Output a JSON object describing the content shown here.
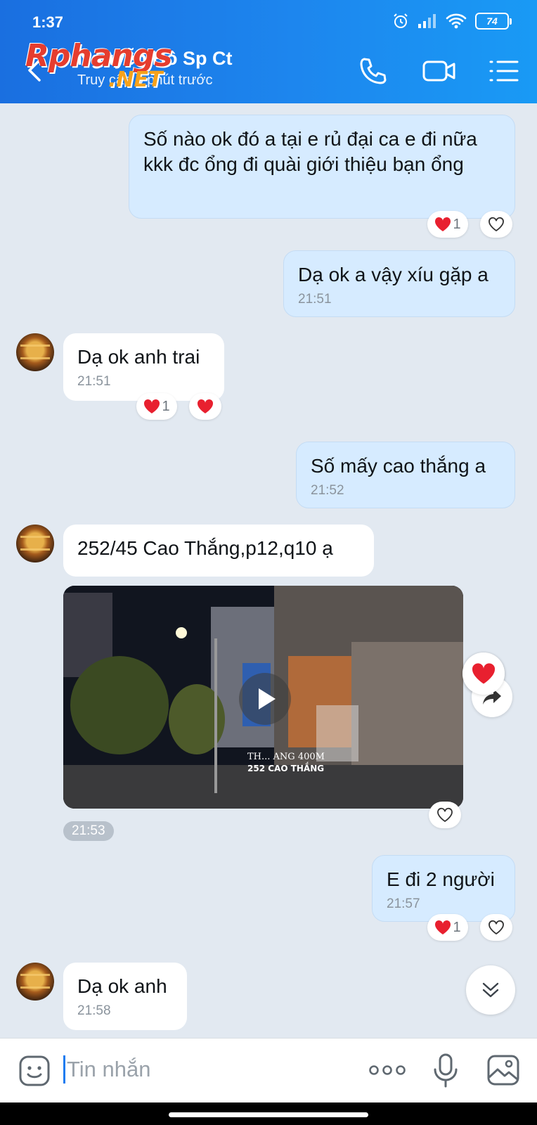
{
  "status_bar": {
    "time": "1:37",
    "battery": "74"
  },
  "header": {
    "contact_name": "Nguyễn Hồ Sp Ct",
    "subtitle": "Truy cập 5 phút trước",
    "watermark_line1": "Rphangs",
    "watermark_line2": ".NET"
  },
  "messages": {
    "m1": {
      "text": "Số nào ok đó a tại e rủ đại ca e đi nữa kkk đc ổng đi quài giới thiệu bạn ổng",
      "reaction_count": "1"
    },
    "m2": {
      "text": "Dạ ok a vậy xíu gặp a",
      "time": "21:51"
    },
    "m3": {
      "text": "Dạ ok anh trai",
      "time": "21:51",
      "reaction_count": "1"
    },
    "m4": {
      "text": "Số mấy cao thắng a",
      "time": "21:52"
    },
    "m5": {
      "text": "252/45 Cao Thắng,p12,q10 ạ"
    },
    "m6": {
      "video_overlay_line1": "TH... ANG 400M",
      "video_overlay_line2": "252 CAO THẮNG",
      "time": "21:53"
    },
    "m7": {
      "text": "E đi 2 người",
      "time": "21:57",
      "reaction_count": "1"
    },
    "m8": {
      "text": "Dạ ok anh",
      "time": "21:58"
    }
  },
  "input": {
    "placeholder": "Tin nhắn"
  },
  "colors": {
    "accent": "#1d86ee",
    "my_bubble": "#d6ebff",
    "heart": "#e8202f"
  }
}
